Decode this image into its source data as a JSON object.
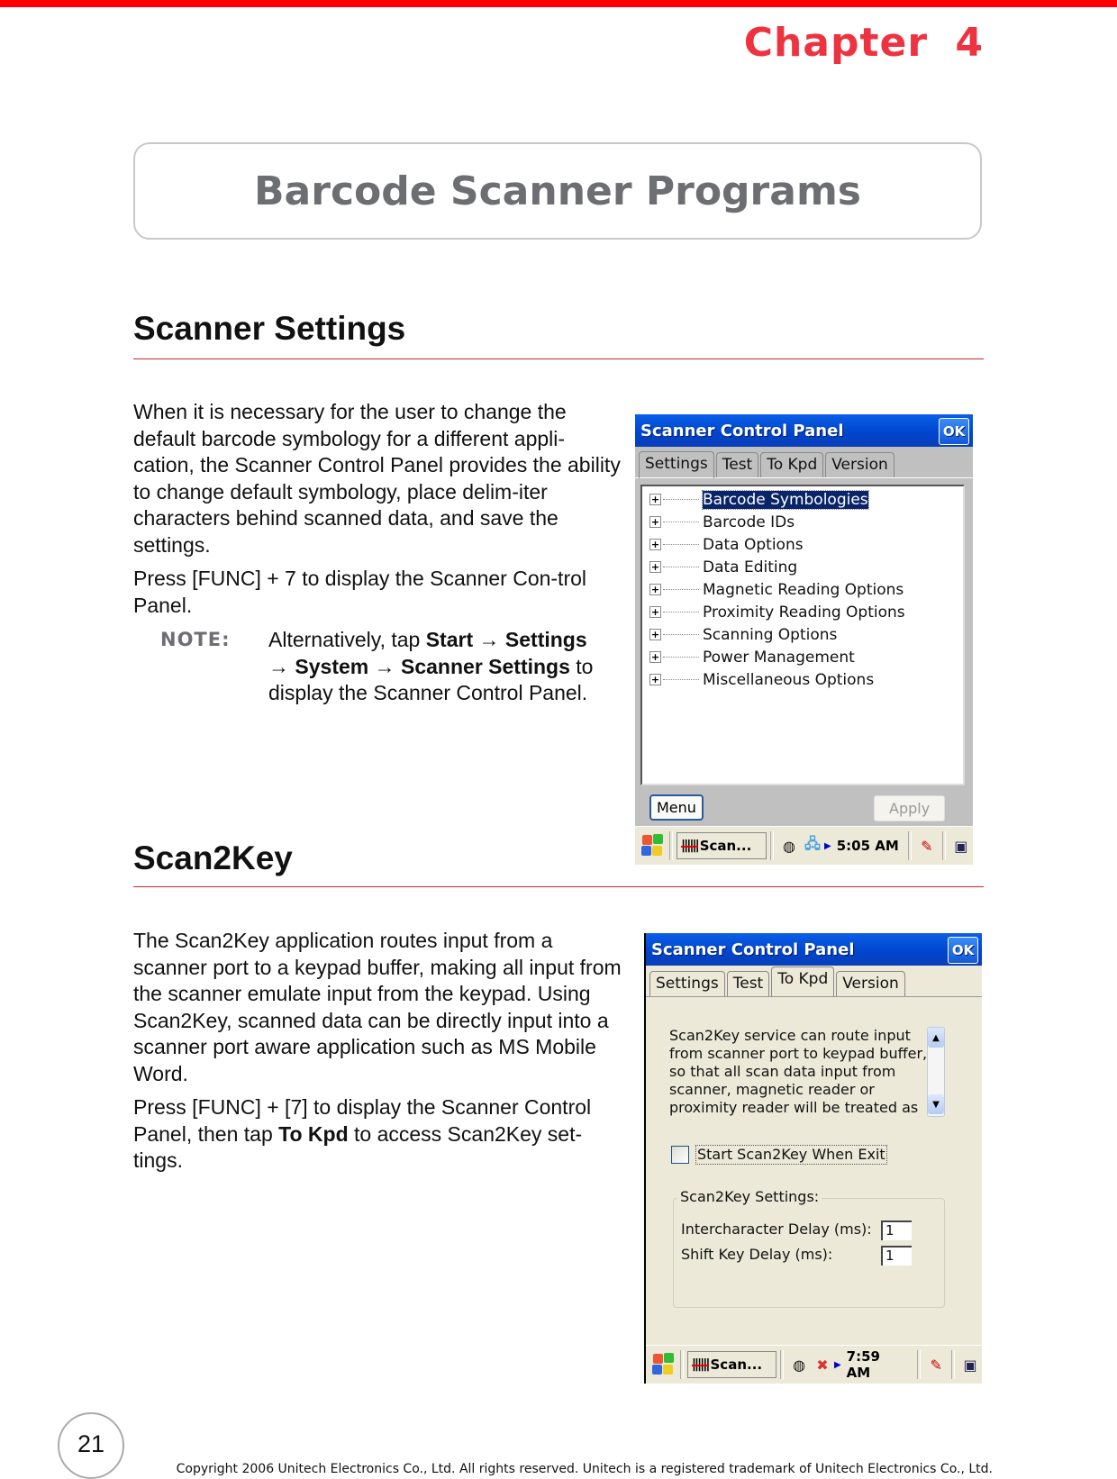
{
  "chapter": "Chapter   4",
  "title": "Barcode Scanner Programs",
  "sections": {
    "scanner_settings": {
      "heading": "Scanner Settings",
      "para1": "When it is necessary for the user to change the default barcode symbology for a different appli-cation, the Scanner Control Panel provides the ability to change default symbology, place delim-iter characters behind scanned data, and save the settings.",
      "para2": "Press [FUNC] + 7 to display the Scanner Con-trol Panel.",
      "note_label": "NOTE:",
      "note": {
        "prefix": "Alternatively, tap ",
        "start": "Start",
        "arrow": " → ",
        "settings": "Settings",
        "system": "System",
        "scanner_settings": "Scanner Settings",
        "suffix": " to display the Scanner Control Panel."
      }
    },
    "scan2key": {
      "heading": "Scan2Key",
      "para1": "The Scan2Key application routes input from a scanner port to a keypad buffer, making all input from the scanner emulate input from the keypad. Using Scan2Key, scanned data can be directly input into a scanner port aware application such as MS Mobile Word.",
      "para2_prefix": "Press [FUNC] + [7] to display the Scanner Control Panel, then tap ",
      "para2_bold": "To Kpd",
      "para2_suffix": " to access Scan2Key set-tings."
    }
  },
  "screen1": {
    "window_title": "Scanner Control Panel",
    "ok_label": "OK",
    "tabs": [
      "Settings",
      "Test",
      "To Kpd",
      "Version"
    ],
    "active_tab": "Settings",
    "tree_items": [
      "Barcode Symbologies",
      "Barcode IDs",
      "Data Options",
      "Data Editing",
      "Magnetic Reading Options",
      "Proximity Reading Options",
      "Scanning Options",
      "Power Management",
      "Miscellaneous Options"
    ],
    "selected_item": "Barcode Symbologies",
    "menu_label": "Menu",
    "apply_label": "Apply",
    "taskbar": {
      "task_label": "Scan...",
      "clock": "5:05 AM"
    }
  },
  "screen2": {
    "window_title": "Scanner Control Panel",
    "ok_label": "OK",
    "tabs": [
      "Settings",
      "Test",
      "To Kpd",
      "Version"
    ],
    "active_tab": "To Kpd",
    "description_lines": [
      "Scan2Key service can route input",
      "from scanner port to keypad buffer,",
      "so that all scan data input from",
      "scanner, magnetic reader or",
      "proximity reader will be treated as"
    ],
    "checkbox_label": "Start Scan2Key When Exit",
    "checkbox_checked": false,
    "group_label": "Scan2Key Settings:",
    "fields": [
      {
        "label": "Intercharacter Delay (ms):",
        "value": "1"
      },
      {
        "label": "Shift Key Delay (ms):",
        "value": "1"
      }
    ],
    "taskbar": {
      "task_label": "Scan...",
      "clock": "7:59 AM"
    }
  },
  "footer": {
    "page_number": "21",
    "copyright": "Copyright 2006 Unitech Electronics Co., Ltd. All rights reserved. Unitech is a registered trademark of Unitech Electronics Co., Ltd."
  },
  "colors": {
    "accent_red": "#ee3340",
    "top_bar": "#ff0000",
    "title_gray": "#6d6e71",
    "ce_titlebar": "#0044cc",
    "selection": "#0a246a"
  }
}
